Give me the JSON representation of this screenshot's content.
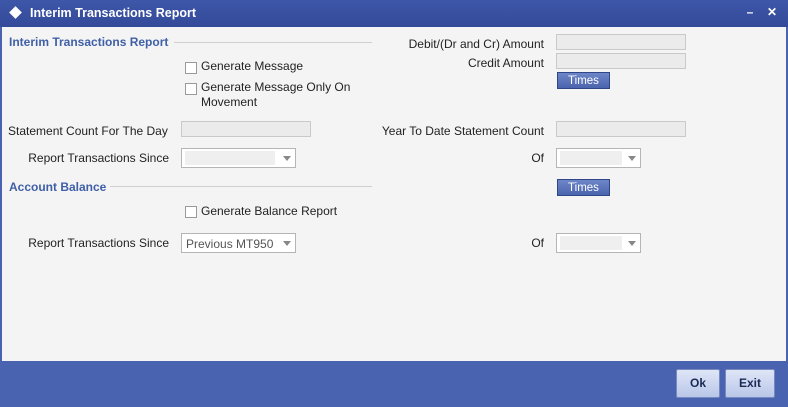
{
  "window": {
    "title": "Interim Transactions Report",
    "minimize_label": "–",
    "close_label": "✕"
  },
  "interim": {
    "section_title": "Interim Transactions Report",
    "generate_message": "Generate Message",
    "generate_message_only_line1": "Generate Message Only On",
    "generate_message_only_line2": "Movement",
    "debit_label": "Debit/(Dr and Cr) Amount",
    "credit_label": "Credit Amount",
    "times_label": "Times",
    "statement_count_label": "Statement Count For The Day",
    "ytd_count_label": "Year To Date Statement Count",
    "report_since_label": "Report Transactions Since",
    "report_since_value": "",
    "of_label": "Of",
    "of_value": ""
  },
  "balance": {
    "section_title": "Account Balance",
    "times_label": "Times",
    "generate_balance": "Generate Balance Report",
    "report_since_label": "Report Transactions Since",
    "report_since_value": "Previous MT950",
    "of_label": "Of",
    "of_value": ""
  },
  "footer": {
    "ok_label": "Ok",
    "exit_label": "Exit"
  },
  "colors": {
    "titlebar": "#3e57a8",
    "section_title": "#3f5fa6",
    "footer": "#4a63b0",
    "content_bg": "#f4f4f4"
  }
}
